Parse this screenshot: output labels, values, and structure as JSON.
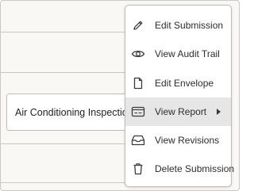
{
  "card": {
    "title": "Air Conditioning Inspection"
  },
  "context_menu": {
    "items": [
      {
        "label": "Edit Submission",
        "icon": "pencil-icon"
      },
      {
        "label": "View Audit Trail",
        "icon": "eye-icon"
      },
      {
        "label": "Edit Envelope",
        "icon": "document-icon"
      },
      {
        "label": "View Report",
        "icon": "report-icon",
        "has_submenu": true,
        "highlighted": true
      },
      {
        "label": "View Revisions",
        "icon": "inbox-icon"
      },
      {
        "label": "Delete Submission",
        "icon": "trash-icon"
      }
    ]
  },
  "colors": {
    "background": "#f9f8f4",
    "menu_background": "#ffffff",
    "highlight": "#e6e6e6",
    "border": "#bdbdbd",
    "text": "#2d2d2d"
  }
}
